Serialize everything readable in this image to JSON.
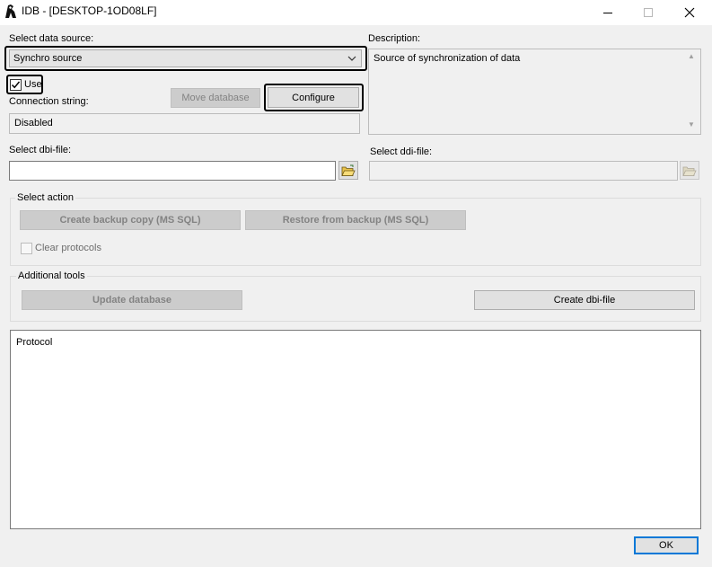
{
  "window": {
    "title": "IDB - [DESKTOP-1OD08LF]"
  },
  "data_source": {
    "label": "Select data source:",
    "selected": "Synchro source",
    "use_label": "Use",
    "use_checked": true
  },
  "description": {
    "label": "Description:",
    "text": "Source of synchronization of data"
  },
  "connection": {
    "label": "Connection string:",
    "value": "Disabled",
    "move_label": "Move database",
    "configure_label": "Configure"
  },
  "dbi": {
    "label": "Select dbi-file:",
    "value": ""
  },
  "ddi": {
    "label": "Select ddi-file:",
    "value": ""
  },
  "select_action": {
    "title": "Select action",
    "backup_label": "Create backup copy (MS SQL)",
    "restore_label": "Restore from backup (MS SQL)",
    "clear_label": "Clear protocols"
  },
  "additional_tools": {
    "title": "Additional tools",
    "update_label": "Update database",
    "create_dbi_label": "Create dbi-file"
  },
  "protocol": {
    "text": "Protocol"
  },
  "footer": {
    "ok_label": "OK"
  }
}
